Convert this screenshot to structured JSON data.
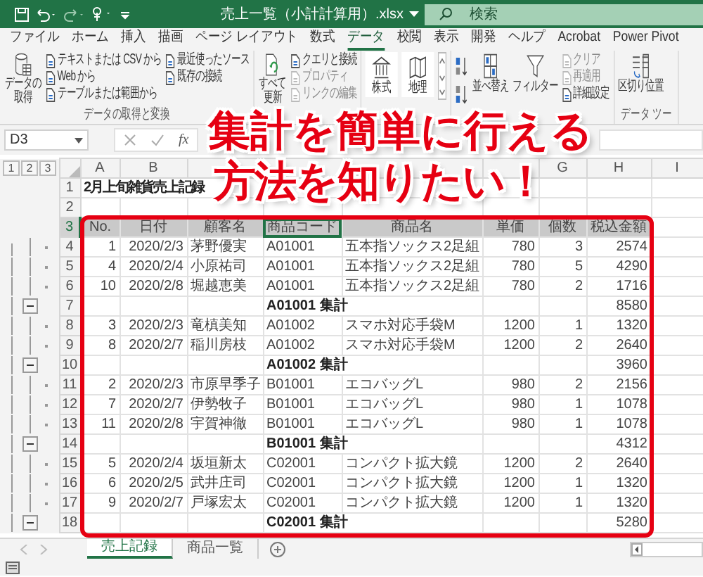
{
  "window": {
    "title": "売上一覧（小計計算用）.xlsx",
    "search_placeholder": "検索"
  },
  "menu_tabs": [
    {
      "label": "ファイル",
      "selected": false
    },
    {
      "label": "ホーム",
      "selected": false
    },
    {
      "label": "挿入",
      "selected": false
    },
    {
      "label": "描画",
      "selected": false
    },
    {
      "label": "ページ レイアウト",
      "selected": false
    },
    {
      "label": "数式",
      "selected": false
    },
    {
      "label": "データ",
      "selected": true
    },
    {
      "label": "校閲",
      "selected": false
    },
    {
      "label": "表示",
      "selected": false
    },
    {
      "label": "開発",
      "selected": false
    },
    {
      "label": "ヘルプ",
      "selected": false
    },
    {
      "label": "Acrobat",
      "selected": false
    },
    {
      "label": "Power Pivot",
      "selected": false
    }
  ],
  "ribbon": {
    "groups": [
      {
        "label": "データの取得と変換",
        "items": [
          {
            "kind": "large",
            "label": "データの取得",
            "disabled": false
          },
          {
            "kind": "stack",
            "items": [
              {
                "label": "テキストまたは CSV から",
                "disabled": false
              },
              {
                "label": "Web から",
                "disabled": false
              },
              {
                "label": "テーブルまたは範囲から",
                "disabled": false
              }
            ]
          },
          {
            "kind": "stack",
            "items": [
              {
                "label": "最近使ったソース",
                "disabled": false
              },
              {
                "label": "既存の接続",
                "disabled": false
              }
            ]
          }
        ]
      },
      {
        "items": [
          {
            "kind": "large",
            "label": "すべて更新",
            "disabled": false
          },
          {
            "kind": "stack",
            "items": [
              {
                "label": "クエリと接続",
                "disabled": false
              },
              {
                "label": "プロパティ",
                "disabled": true
              },
              {
                "label": "リンクの編集",
                "disabled": true
              }
            ]
          }
        ]
      },
      {
        "items": [
          {
            "kind": "type",
            "label": "株式",
            "disabled": false
          },
          {
            "kind": "type",
            "label": "地理",
            "disabled": false
          }
        ]
      },
      {
        "items": [
          {
            "kind": "sort_pair"
          },
          {
            "kind": "large",
            "label": "並べ替え",
            "disabled": false
          },
          {
            "kind": "large",
            "label": "フィルター",
            "disabled": false
          },
          {
            "kind": "stack",
            "items": [
              {
                "label": "クリア",
                "disabled": true
              },
              {
                "label": "再適用",
                "disabled": true
              },
              {
                "label": "詳細設定",
                "disabled": false
              }
            ]
          }
        ]
      },
      {
        "label": "データ ツー",
        "items": [
          {
            "kind": "large",
            "label": "区切り位置",
            "disabled": false
          }
        ]
      }
    ]
  },
  "formula_bar": {
    "name_box": "D3",
    "fx": "fx"
  },
  "outline_levels": [
    "1",
    "2",
    "3"
  ],
  "columns": [
    {
      "label": "A"
    },
    {
      "label": "B"
    },
    null,
    null,
    null,
    null,
    {
      "label": "G"
    },
    {
      "label": "H"
    },
    {
      "label": "I"
    }
  ],
  "rows": [
    {
      "num": "1",
      "kind": "title",
      "text": "2月上旬雑貨売上記録",
      "selected": false
    },
    {
      "num": "2",
      "kind": "blank",
      "selected": false
    },
    {
      "num": "3",
      "kind": "header",
      "cells": [
        "No.",
        "日付",
        "顧客名",
        "商品コード",
        "商品名",
        "単価",
        "個数",
        "税込金額"
      ],
      "selected": true
    },
    {
      "num": "4",
      "kind": "detail",
      "cells": [
        "1",
        "2020/2/3",
        "茅野優実",
        "A01001",
        "五本指ソックス2足組",
        "780",
        "3",
        "2574"
      ],
      "selected": false
    },
    {
      "num": "5",
      "kind": "detail",
      "cells": [
        "4",
        "2020/2/4",
        "小原祐司",
        "A01001",
        "五本指ソックス2足組",
        "780",
        "5",
        "4290"
      ],
      "selected": false
    },
    {
      "num": "6",
      "kind": "detail",
      "cells": [
        "10",
        "2020/2/8",
        "堀越恵美",
        "A01001",
        "五本指ソックス2足組",
        "780",
        "2",
        "1716"
      ],
      "selected": false
    },
    {
      "num": "7",
      "kind": "subtotal",
      "label": "A01001 集計",
      "total": "8580",
      "selected": false
    },
    {
      "num": "8",
      "kind": "detail",
      "cells": [
        "3",
        "2020/2/3",
        "竜槙美知",
        "A01002",
        "スマホ対応手袋M",
        "1200",
        "1",
        "1320"
      ],
      "selected": false
    },
    {
      "num": "9",
      "kind": "detail",
      "cells": [
        "8",
        "2020/2/7",
        "稲川房枝",
        "A01002",
        "スマホ対応手袋M",
        "1200",
        "2",
        "2640"
      ],
      "selected": false
    },
    {
      "num": "10",
      "kind": "subtotal",
      "label": "A01002 集計",
      "total": "3960",
      "selected": false
    },
    {
      "num": "11",
      "kind": "detail",
      "cells": [
        "2",
        "2020/2/3",
        "市原早季子",
        "B01001",
        "エコバッグL",
        "980",
        "2",
        "2156"
      ],
      "selected": false
    },
    {
      "num": "12",
      "kind": "detail",
      "cells": [
        "7",
        "2020/2/7",
        "伊勢牧子",
        "B01001",
        "エコバッグL",
        "980",
        "1",
        "1078"
      ],
      "selected": false
    },
    {
      "num": "13",
      "kind": "detail",
      "cells": [
        "11",
        "2020/2/8",
        "宇賀神徹",
        "B01001",
        "エコバッグL",
        "980",
        "1",
        "1078"
      ],
      "selected": false
    },
    {
      "num": "14",
      "kind": "subtotal",
      "label": "B01001 集計",
      "total": "4312",
      "selected": false
    },
    {
      "num": "15",
      "kind": "detail",
      "cells": [
        "5",
        "2020/2/4",
        "坂垣新太",
        "C02001",
        "コンパクト拡大鏡",
        "1200",
        "2",
        "2640"
      ],
      "selected": false
    },
    {
      "num": "16",
      "kind": "detail",
      "cells": [
        "6",
        "2020/2/5",
        "武井庄司",
        "C02001",
        "コンパクト拡大鏡",
        "1200",
        "1",
        "1320"
      ],
      "selected": false
    },
    {
      "num": "17",
      "kind": "detail",
      "cells": [
        "9",
        "2020/2/7",
        "戸塚宏太",
        "C02001",
        "コンパクト拡大鏡",
        "1200",
        "1",
        "1320"
      ],
      "selected": false
    },
    {
      "num": "18",
      "kind": "subtotal",
      "label": "C02001 集計",
      "total": "5280",
      "selected": false
    }
  ],
  "sheet_tabs": [
    {
      "label": "売上記録",
      "selected": true
    },
    {
      "label": "商品一覧",
      "selected": false
    }
  ],
  "caption": [
    "集計を簡単に行える",
    "方法を知りたい！"
  ]
}
